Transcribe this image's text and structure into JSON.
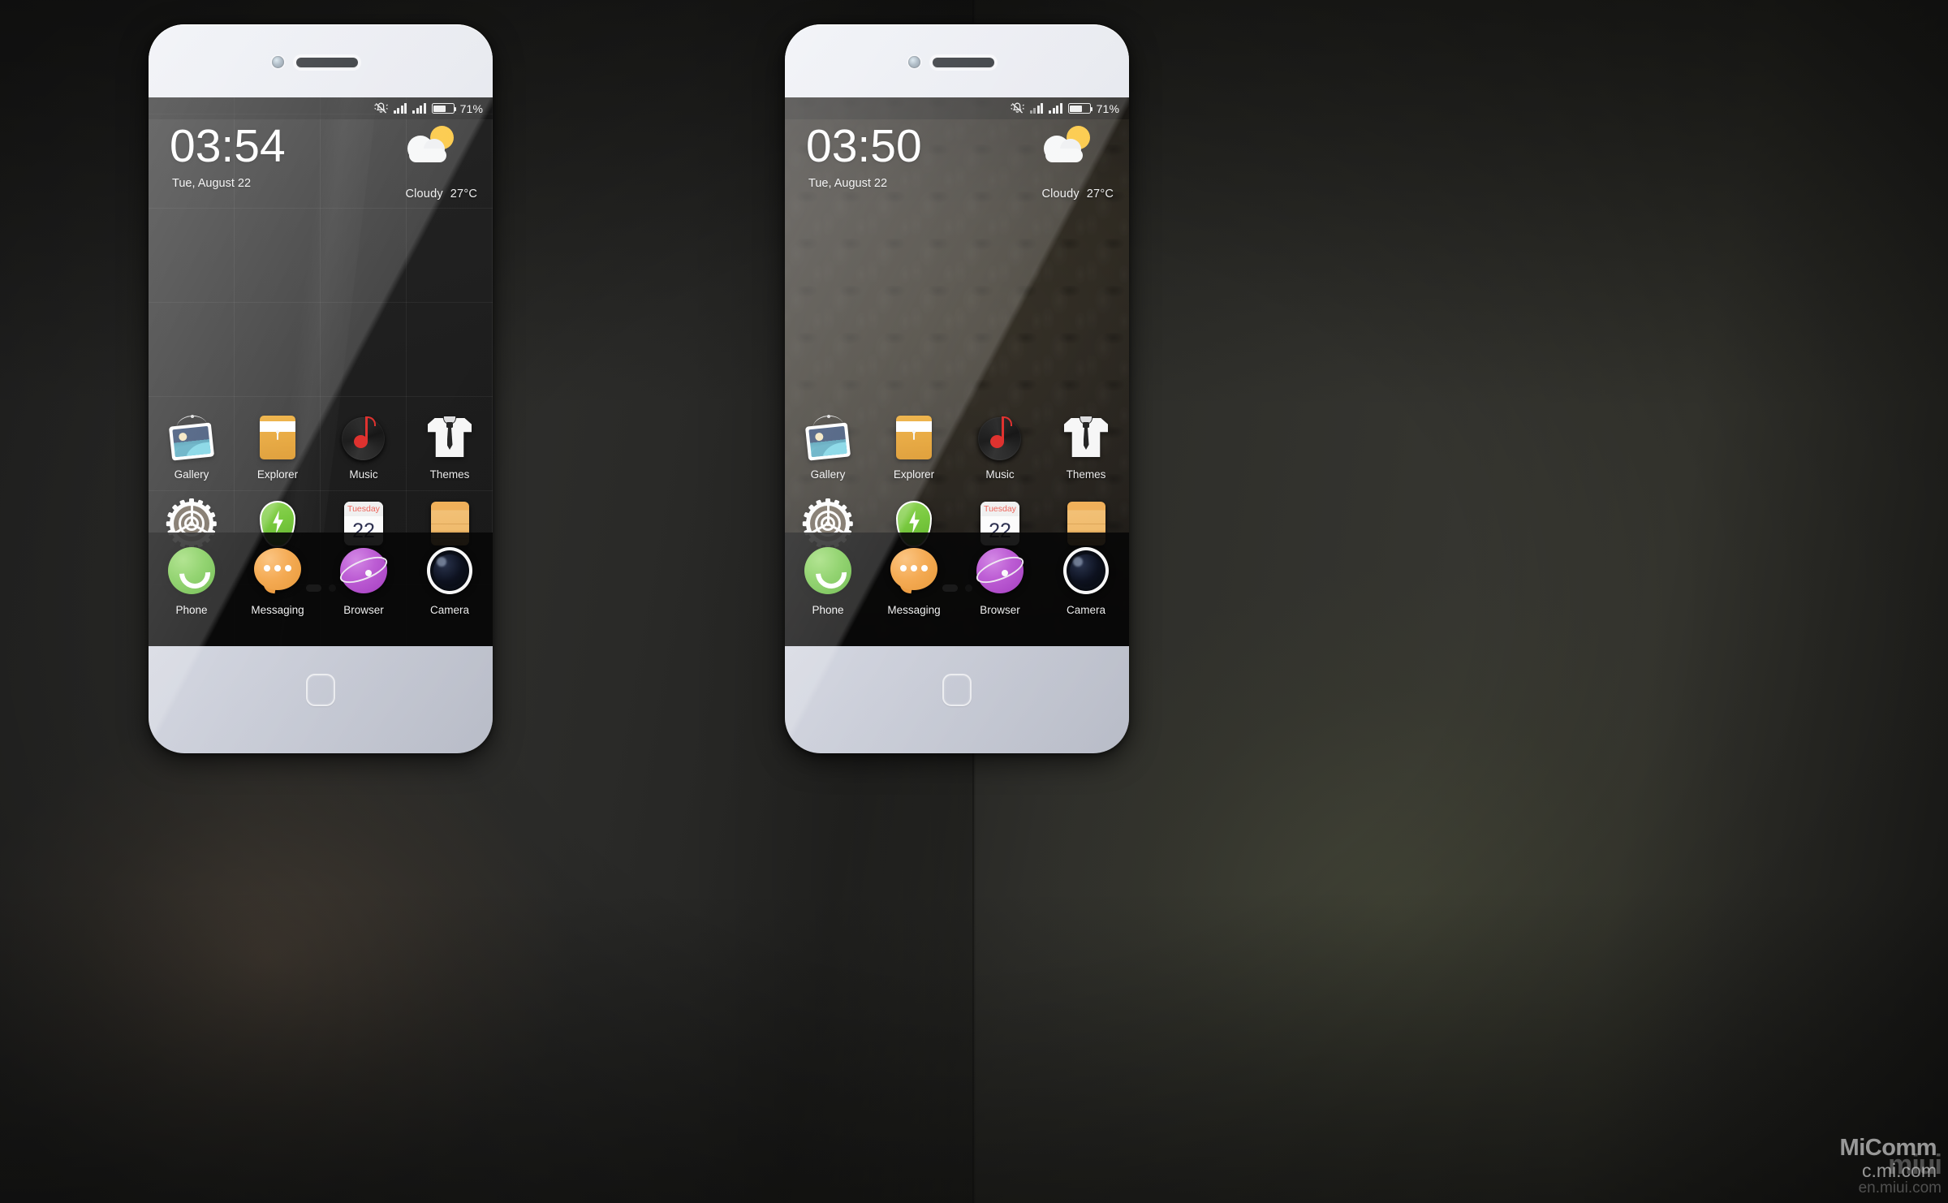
{
  "scene": {
    "background_color": "#2c2c29",
    "accent_green": "#79c94f",
    "accent_orange": "#f5ab53",
    "accent_purple": "#c05fd8",
    "accent_yellow": "#fcc12b"
  },
  "watermark": {
    "brand_primary": "MiComm",
    "url_primary": "c.mi.com",
    "brand_secondary": "miui",
    "url_secondary": "en.miui.com"
  },
  "phones": [
    {
      "id": "phone-left",
      "wallpaper": "flat-dark-grid",
      "status_bar": {
        "silent_icon": "bell-slash-icon",
        "signal_1_icon": "signal-bars-icon",
        "signal_2_icon": "signal-bars-icon",
        "battery_icon": "battery-icon",
        "battery_percent": "71%"
      },
      "clock_widget": {
        "time": "03:54",
        "date": "Tue, August 22",
        "weather_icon": "sun-behind-cloud-icon",
        "weather_condition": "Cloudy",
        "weather_temp": "27°C"
      },
      "apps": [
        {
          "label": "Gallery",
          "icon": "gallery-icon"
        },
        {
          "label": "Explorer",
          "icon": "explorer-icon"
        },
        {
          "label": "Music",
          "icon": "music-icon"
        },
        {
          "label": "Themes",
          "icon": "themes-icon"
        },
        {
          "label": "Settings",
          "icon": "settings-icon"
        },
        {
          "label": "Security",
          "icon": "security-icon"
        },
        {
          "label": "Calendar",
          "icon": "calendar-icon",
          "badge_weekday": "Tuesday",
          "badge_day": "22"
        },
        {
          "label": "Notes",
          "icon": "notes-icon"
        }
      ],
      "page_indicator": {
        "count": 2,
        "active_index": 0
      },
      "dock": [
        {
          "label": "Phone",
          "icon": "phone-handset-icon"
        },
        {
          "label": "Messaging",
          "icon": "chat-bubble-icon"
        },
        {
          "label": "Browser",
          "icon": "planet-icon"
        },
        {
          "label": "Camera",
          "icon": "camera-lens-icon"
        }
      ]
    },
    {
      "id": "phone-right",
      "wallpaper": "damask-pattern",
      "status_bar": {
        "silent_icon": "bell-slash-icon",
        "signal_1_icon": "signal-bars-icon",
        "signal_2_icon": "signal-bars-icon",
        "battery_icon": "battery-icon",
        "battery_percent": "71%"
      },
      "clock_widget": {
        "time": "03:50",
        "date": "Tue, August 22",
        "weather_icon": "sun-behind-cloud-icon",
        "weather_condition": "Cloudy",
        "weather_temp": "27°C"
      },
      "apps": [
        {
          "label": "Gallery",
          "icon": "gallery-icon"
        },
        {
          "label": "Explorer",
          "icon": "explorer-icon"
        },
        {
          "label": "Music",
          "icon": "music-icon"
        },
        {
          "label": "Themes",
          "icon": "themes-icon"
        },
        {
          "label": "Settings",
          "icon": "settings-icon"
        },
        {
          "label": "Security",
          "icon": "security-icon"
        },
        {
          "label": "Calendar",
          "icon": "calendar-icon",
          "badge_weekday": "Tuesday",
          "badge_day": "22"
        },
        {
          "label": "Notes",
          "icon": "notes-icon"
        }
      ],
      "page_indicator": {
        "count": 2,
        "active_index": 0
      },
      "dock": [
        {
          "label": "Phone",
          "icon": "phone-handset-icon"
        },
        {
          "label": "Messaging",
          "icon": "chat-bubble-icon"
        },
        {
          "label": "Browser",
          "icon": "planet-icon"
        },
        {
          "label": "Camera",
          "icon": "camera-lens-icon"
        }
      ]
    }
  ]
}
